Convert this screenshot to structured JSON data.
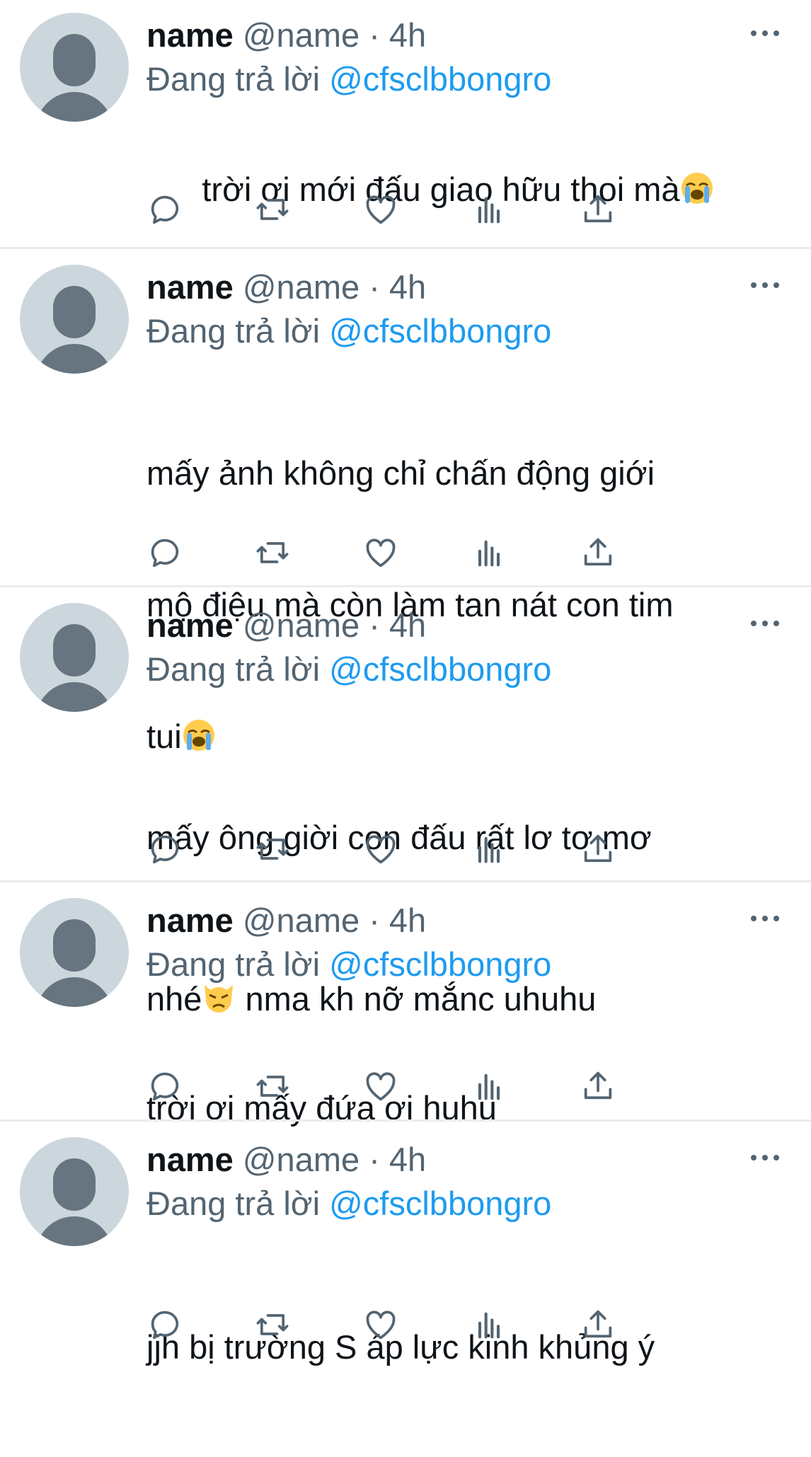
{
  "tweets": [
    {
      "name": "name",
      "handle": "@name",
      "separator": "·",
      "time": "4h",
      "reply_prefix": "Đang trả lời",
      "reply_to": "@cfsclbbongro",
      "lines": [
        "trời ơi mới đấu giao hữu thoi mà"
      ],
      "emoji": "loudly-crying-face"
    },
    {
      "name": "name",
      "handle": "@name",
      "separator": "·",
      "time": "4h",
      "reply_prefix": "Đang trả lời",
      "reply_to": "@cfsclbbongro",
      "lines": [
        "mấy ảnh không chỉ chấn động giới",
        "mộ điệu mà còn làm tan nát con tim",
        "tui"
      ],
      "emoji": "loudly-crying-face"
    },
    {
      "name": "name",
      "handle": "@name",
      "separator": "·",
      "time": "4h",
      "reply_prefix": "Đang trả lời",
      "reply_to": "@cfsclbbongro",
      "lines": [
        "mấy ông giời con đấu rất lơ tơ mơ",
        "nhé",
        " nma kh nỡ mắnc uhuhu"
      ],
      "emoji": "pouting-cat-face"
    },
    {
      "name": "name",
      "handle": "@name",
      "separator": "·",
      "time": "4h",
      "reply_prefix": "Đang trả lời",
      "reply_to": "@cfsclbbongro",
      "lines": [
        "trời ơi mấy đứa ơi huhu"
      ]
    },
    {
      "name": "name",
      "handle": "@name",
      "separator": "·",
      "time": "4h",
      "reply_prefix": "Đang trả lời",
      "reply_to": "@cfsclbbongro",
      "lines": [
        "jjh bị trường S áp lực kinh khủng ý"
      ]
    }
  ],
  "icons": {
    "more": "more-horizontal-icon",
    "reply": "reply-icon",
    "retweet": "retweet-icon",
    "like": "like-icon",
    "views": "views-icon",
    "share": "share-icon"
  },
  "colors": {
    "text": "#0f1419",
    "secondary": "#536471",
    "mention": "#1d9bf0",
    "avatar_bg": "#ccd6dd",
    "avatar_fg": "#66757f",
    "divider": "#e9ecef"
  }
}
